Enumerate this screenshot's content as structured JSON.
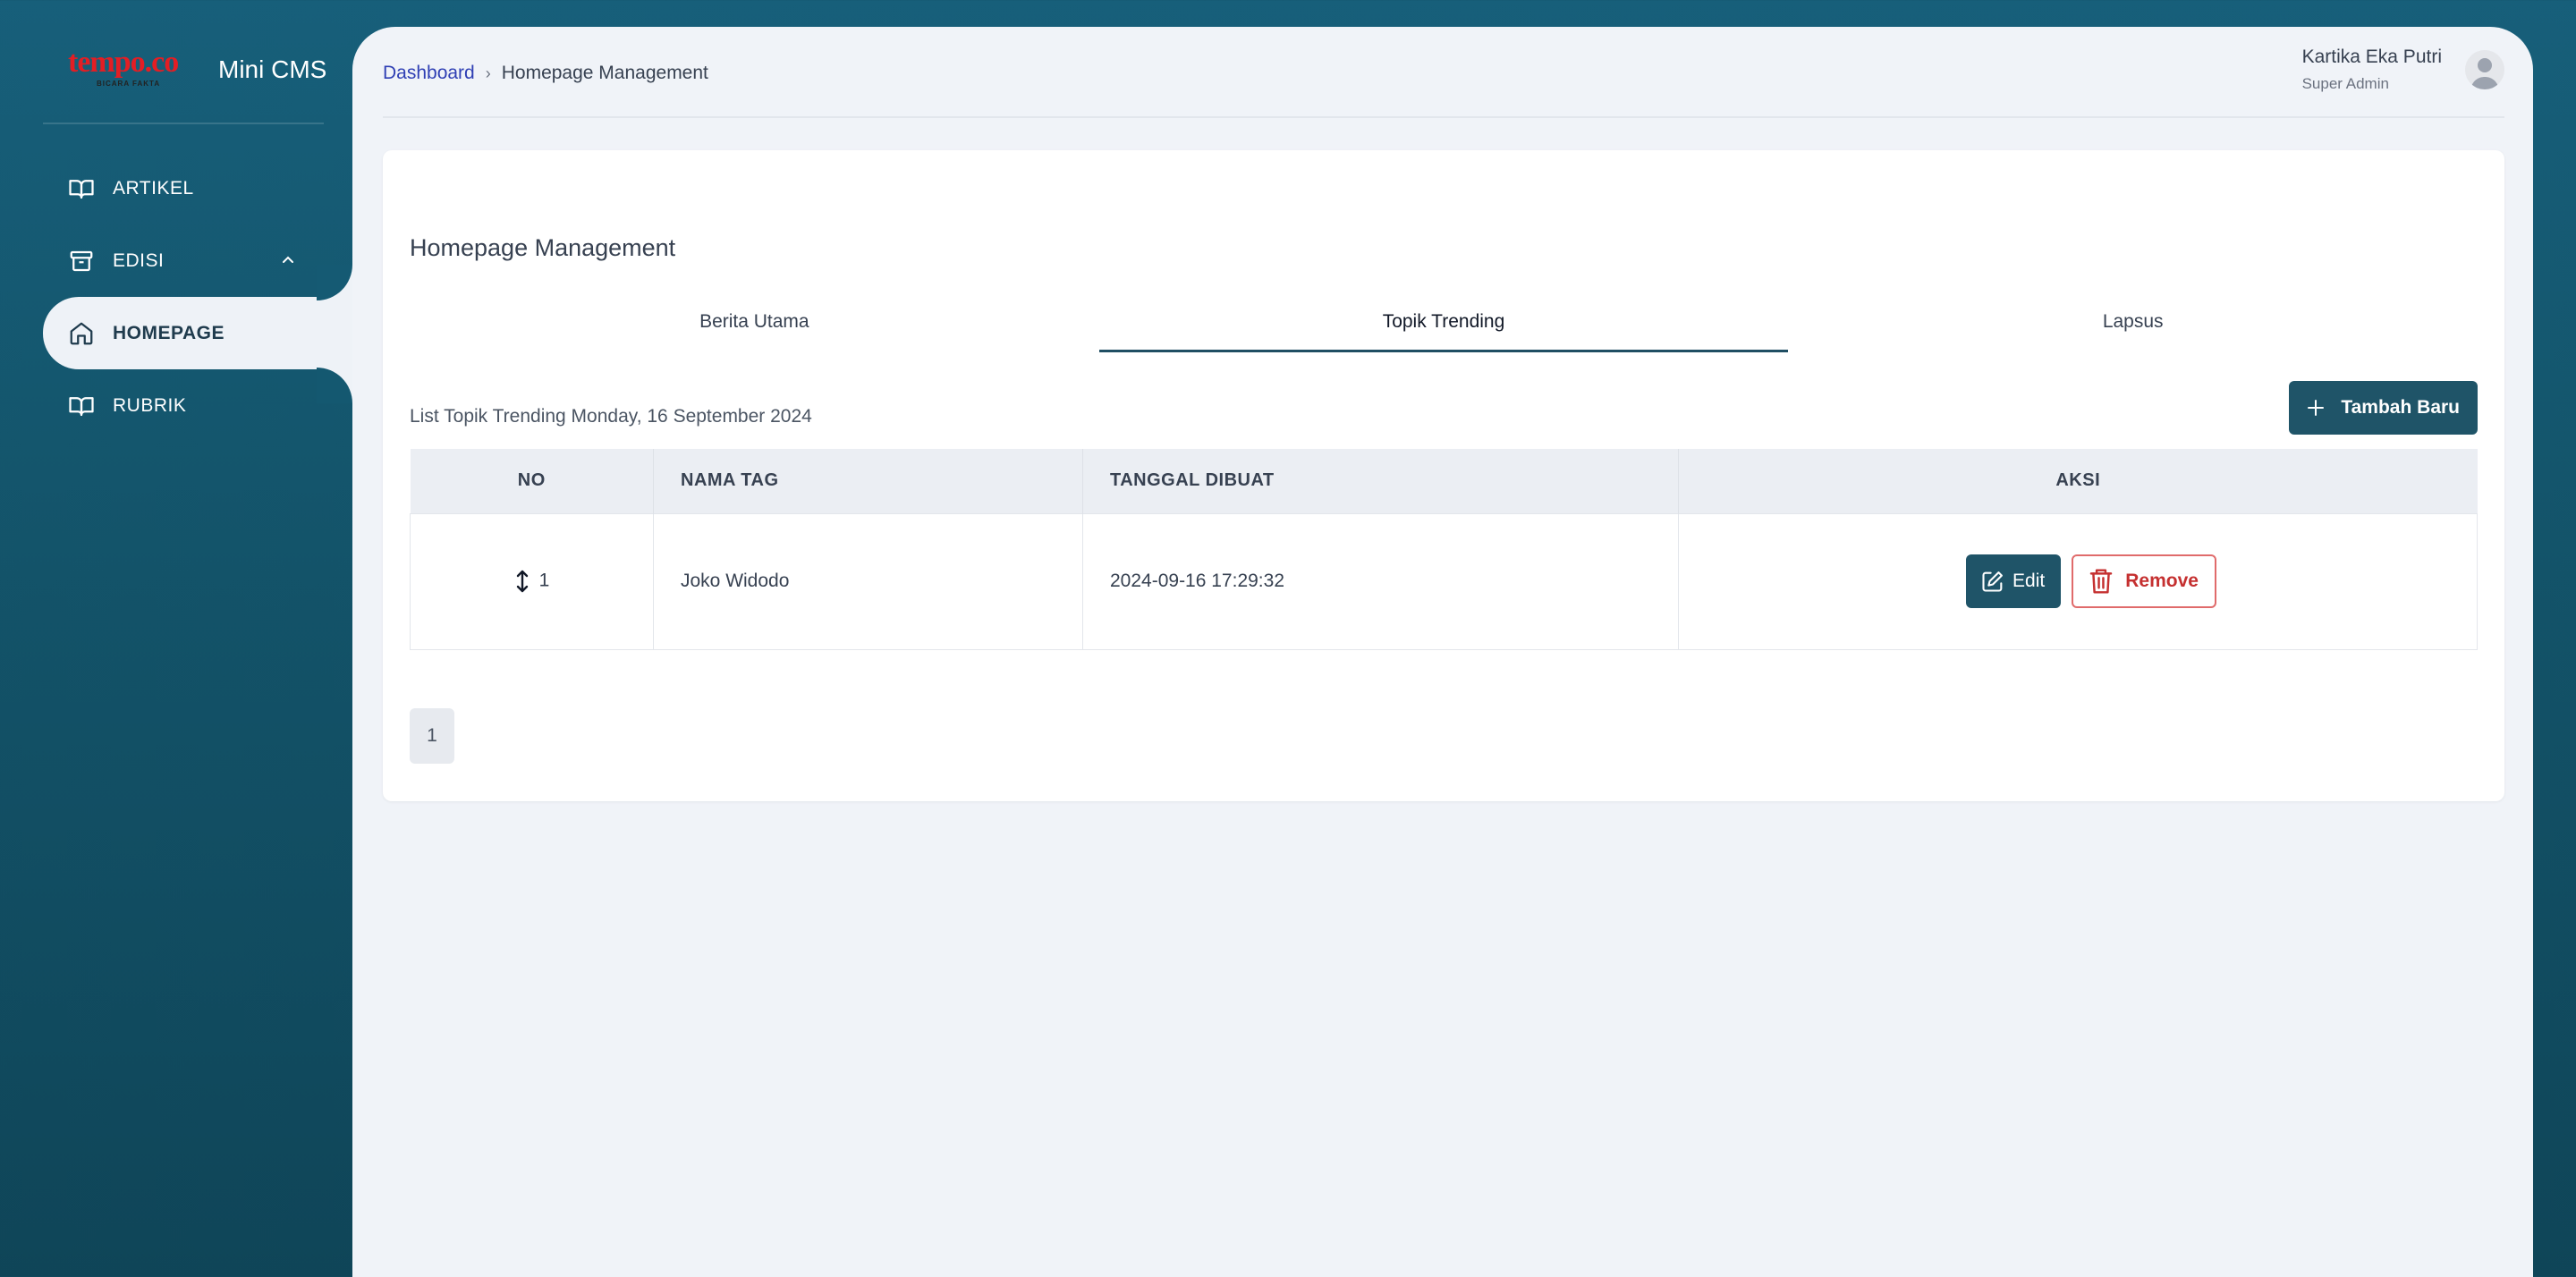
{
  "brand": {
    "logo_text": "tempo.co",
    "logo_tagline": "BICARA FAKTA",
    "app_title": "Mini CMS"
  },
  "sidebar": {
    "items": [
      {
        "label": "ARTIKEL",
        "icon": "book-open-icon"
      },
      {
        "label": "EDISI",
        "icon": "archive-icon",
        "expanded": true
      },
      {
        "label": "HOMEPAGE",
        "icon": "home-icon",
        "active": true
      },
      {
        "label": "RUBRIK",
        "icon": "book-open-icon"
      }
    ]
  },
  "header": {
    "breadcrumb": {
      "root": "Dashboard",
      "current": "Homepage Management"
    },
    "user": {
      "name": "Kartika Eka Putri",
      "role": "Super Admin"
    }
  },
  "main": {
    "title": "Homepage Management",
    "tabs": [
      {
        "label": "Berita Utama",
        "active": false
      },
      {
        "label": "Topik Trending",
        "active": true
      },
      {
        "label": "Lapsus",
        "active": false
      }
    ],
    "list_caption": "List Topik Trending Monday, 16 September 2024",
    "add_button": "Tambah Baru",
    "table": {
      "columns": [
        "NO",
        "NAMA TAG",
        "TANGGAL DIBUAT",
        "AKSI"
      ],
      "rows": [
        {
          "no": "1",
          "nama_tag": "Joko Widodo",
          "tanggal": "2024-09-16 17:29:32"
        }
      ],
      "edit_label": "Edit",
      "remove_label": "Remove"
    },
    "pagination": {
      "current": "1"
    }
  },
  "colors": {
    "sidebar_bg": "#155a73",
    "primary_button": "#1f5468",
    "danger": "#c53030",
    "link": "#2f3fb4"
  }
}
